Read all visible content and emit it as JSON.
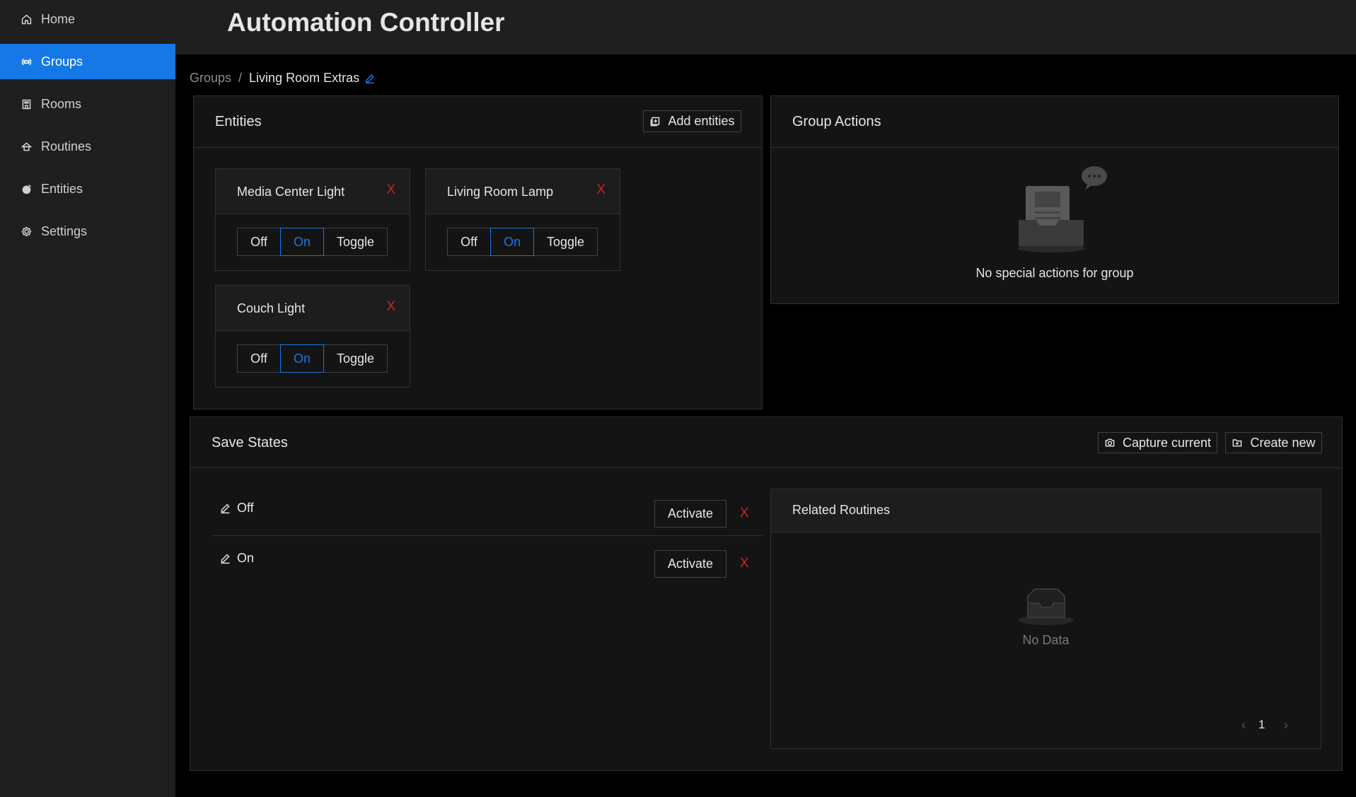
{
  "app": {
    "title": "Automation Controller"
  },
  "sidebar": {
    "items": [
      {
        "label": "Home",
        "icon": "home-icon",
        "active": false
      },
      {
        "label": "Groups",
        "icon": "groups-icon",
        "active": true
      },
      {
        "label": "Rooms",
        "icon": "rooms-icon",
        "active": false
      },
      {
        "label": "Routines",
        "icon": "routines-icon",
        "active": false
      },
      {
        "label": "Entities",
        "icon": "entities-icon",
        "active": false
      },
      {
        "label": "Settings",
        "icon": "gear-icon",
        "active": false
      }
    ]
  },
  "breadcrumb": {
    "parent": "Groups",
    "separator": "/",
    "current": "Living Room Extras"
  },
  "entities_panel": {
    "title": "Entities",
    "add_label": "Add entities",
    "entities": [
      {
        "name": "Media Center Light",
        "close": "X",
        "options": [
          "Off",
          "On",
          "Toggle"
        ],
        "selected": "On"
      },
      {
        "name": "Living Room Lamp",
        "close": "X",
        "options": [
          "Off",
          "On",
          "Toggle"
        ],
        "selected": "On"
      },
      {
        "name": "Couch Light",
        "close": "X",
        "options": [
          "Off",
          "On",
          "Toggle"
        ],
        "selected": "On"
      }
    ]
  },
  "group_actions": {
    "title": "Group Actions",
    "empty_text": "No special actions for group"
  },
  "save_states": {
    "title": "Save States",
    "capture_label": "Capture current",
    "create_label": "Create new",
    "states": [
      {
        "label": "Off",
        "activate": "Activate",
        "delete": "X"
      },
      {
        "label": "On",
        "activate": "Activate",
        "delete": "X"
      }
    ]
  },
  "related_routines": {
    "title": "Related Routines",
    "empty_text": "No Data",
    "page": "1"
  },
  "colors": {
    "accent": "#1677e6",
    "danger": "#d32029",
    "sidebar_bg": "#1f1f1f",
    "card_bg": "#141414"
  }
}
